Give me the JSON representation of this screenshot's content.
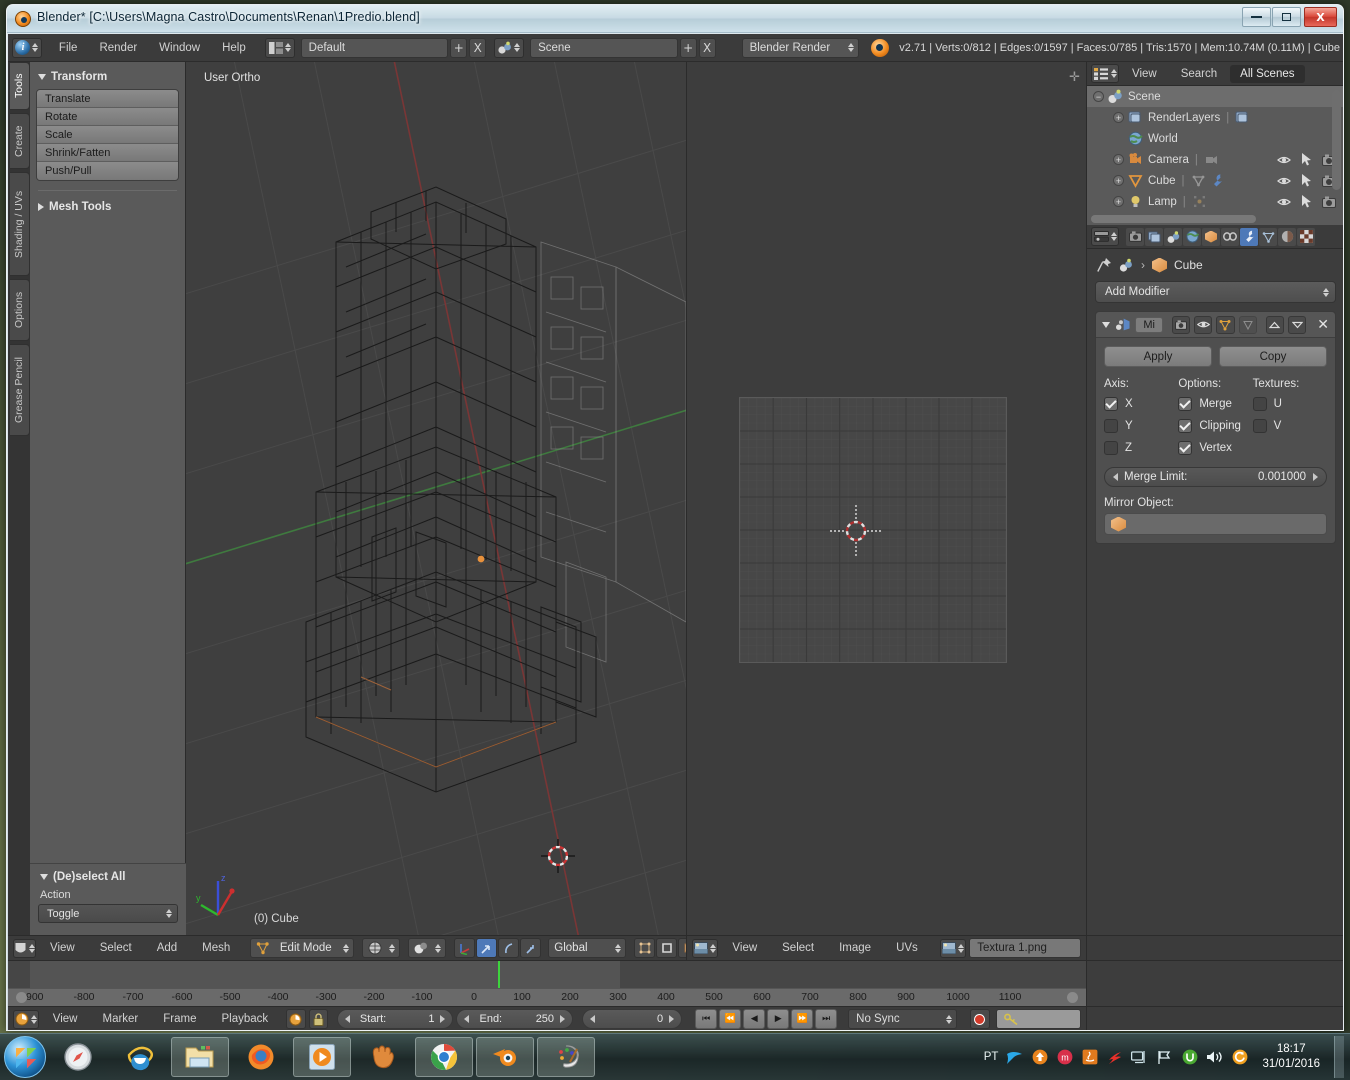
{
  "window": {
    "title": "Blender* [C:\\Users\\Magna Castro\\Documents\\Renan\\1Predio.blend]",
    "minimize_label": "Minimize",
    "maximize_label": "Maximize",
    "close_label": "X"
  },
  "topbar": {
    "menus": [
      "File",
      "Render",
      "Window",
      "Help"
    ],
    "screen_layout": "Default",
    "scene_name": "Scene",
    "render_engine": "Blender Render",
    "add_label": "+",
    "remove_label": "X",
    "stats": "v2.71 | Verts:0/812 | Edges:0/1597 | Faces:0/785 | Tris:1570 | Mem:10.74M (0.11M) | Cube"
  },
  "toolshelf": {
    "tabs": [
      "Tools",
      "Create",
      "Shading / UVs",
      "Options",
      "Grease Pencil"
    ],
    "active_tab": "Tools",
    "transform_panel_title": "Transform",
    "transform_buttons": [
      "Translate",
      "Rotate",
      "Scale",
      "Shrink/Fatten",
      "Push/Pull"
    ],
    "mesh_tools_title": "Mesh Tools",
    "operator_panel_title": "(De)select All",
    "operator_label": "Action",
    "operator_value": "Toggle"
  },
  "viewport": {
    "view_label": "User Ortho",
    "object_label": "(0) Cube",
    "axis_x": "x",
    "axis_y": "y",
    "axis_z": "z"
  },
  "uveditor": {
    "menus": [
      "View",
      "Select",
      "Image",
      "UVs"
    ],
    "image_name": "Textura 1.png"
  },
  "outliner": {
    "menus": [
      "View",
      "Search"
    ],
    "display_mode": "All Scenes",
    "rows": [
      {
        "name": "Scene",
        "icon": "scene-icon",
        "indent": 0,
        "selected": true,
        "expander": "minus",
        "eye": false
      },
      {
        "name": "RenderLayers",
        "icon": "renderlayers-icon",
        "indent": 1,
        "selected": false,
        "expander": "plus",
        "eye": false
      },
      {
        "name": "World",
        "icon": "world-icon",
        "indent": 1,
        "selected": false,
        "expander": "none",
        "eye": false
      },
      {
        "name": "Camera",
        "icon": "camera-icon",
        "indent": 1,
        "selected": false,
        "expander": "plus",
        "eye": true
      },
      {
        "name": "Cube",
        "icon": "mesh-icon",
        "indent": 1,
        "selected": false,
        "expander": "plus",
        "eye": true
      },
      {
        "name": "Lamp",
        "icon": "lamp-icon",
        "indent": 1,
        "selected": false,
        "expander": "plus",
        "eye": true
      }
    ]
  },
  "properties": {
    "tabs": [
      "render-tab",
      "render-layers-tab",
      "scene-tab",
      "world-tab",
      "object-tab",
      "constraints-tab",
      "modifiers-tab",
      "data-tab",
      "material-tab",
      "texture-tab"
    ],
    "active_tab": "modifiers-tab",
    "breadcrumb_object": "Cube",
    "add_modifier_label": "Add Modifier",
    "modifier_name": "Mi",
    "apply_label": "Apply",
    "copy_label": "Copy",
    "axis_title": "Axis:",
    "options_title": "Options:",
    "textures_title": "Textures:",
    "axis": [
      {
        "label": "X",
        "checked": true
      },
      {
        "label": "Y",
        "checked": false
      },
      {
        "label": "Z",
        "checked": false
      }
    ],
    "options": [
      {
        "label": "Merge",
        "checked": true
      },
      {
        "label": "Clipping",
        "checked": true
      },
      {
        "label": "Vertex",
        "checked": true
      }
    ],
    "textures": [
      {
        "label": "U",
        "checked": false
      },
      {
        "label": "V",
        "checked": false
      }
    ],
    "merge_limit_label": "Merge Limit:",
    "merge_limit_value": "0.001000",
    "mirror_object_label": "Mirror Object:",
    "mirror_object_value": ""
  },
  "header3d": {
    "menus": [
      "View",
      "Select",
      "Add",
      "Mesh"
    ],
    "mode": "Edit Mode",
    "orientation": "Global"
  },
  "timeline": {
    "menus": [
      "View",
      "Marker",
      "Frame",
      "Playback"
    ],
    "start_label": "Start:",
    "start_value": "1",
    "end_label": "End:",
    "end_value": "250",
    "current_frame": "0",
    "sync_mode": "No Sync",
    "ruler_ticks": [
      "-900",
      "-800",
      "-700",
      "-600",
      "-500",
      "-400",
      "-300",
      "-200",
      "-100",
      "0",
      "100",
      "200",
      "300",
      "400",
      "500",
      "600",
      "700",
      "800",
      "900",
      "1000",
      "1100"
    ],
    "playhead_frame": "0"
  },
  "taskbar": {
    "pinned": [
      "safari-icon",
      "internet-explorer-icon",
      "file-explorer-icon",
      "firefox-icon",
      "media-player-icon",
      "gimp-icon",
      "chrome-icon",
      "blender-icon",
      "paint-icon"
    ],
    "tray_language": "PT",
    "tray_icons": [
      "speedtest-icon",
      "update-icon",
      "mega-icon",
      "java-icon",
      "flash-icon",
      "network-monitor-icon",
      "network-icon",
      "utorrent-icon",
      "volume-icon",
      "sync-icon"
    ],
    "clock_time": "18:17",
    "clock_date": "31/01/2016"
  },
  "colors": {
    "accent_blue": "#4e79b8",
    "blender_orange": "#f28a1e",
    "selected_green": "#3dd43d",
    "panel_bg": "#5a5a5a",
    "header_bg": "#3b3b3b",
    "viewport_bg": "#3f3f3f"
  }
}
